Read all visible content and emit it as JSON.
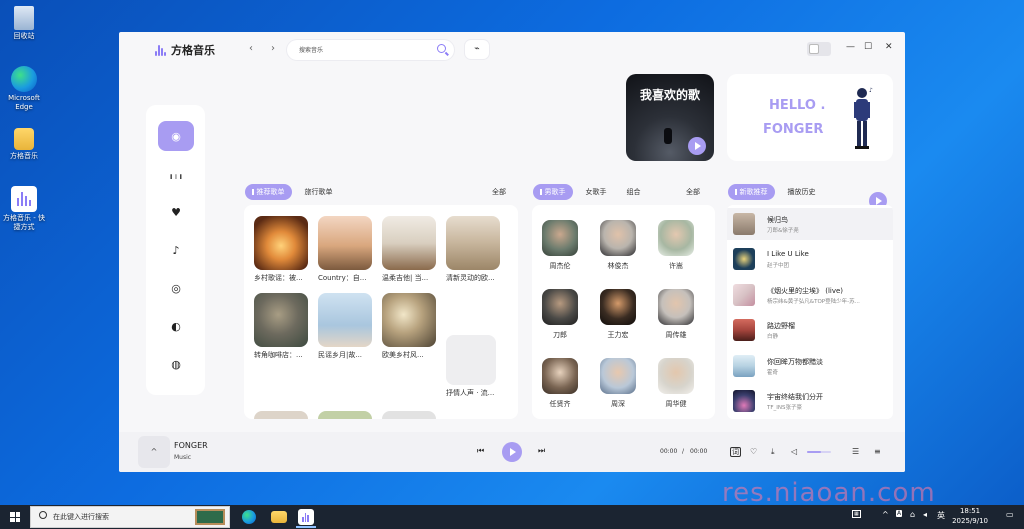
{
  "desktop": {
    "icons": [
      {
        "label": "回收站",
        "icon": "recycle-bin-icon"
      },
      {
        "label": "Microsoft Edge",
        "icon": "edge-icon"
      },
      {
        "label": "方格音乐",
        "icon": "folder-icon"
      },
      {
        "label": "方格音乐 - 快捷方式",
        "icon": "app-shortcut-icon"
      }
    ]
  },
  "app": {
    "name": "方格音乐",
    "search": {
      "placeholder": "搜索音乐"
    },
    "nav_back": "‹",
    "nav_forward": "›",
    "pulse": "⌁",
    "window": {
      "minimize": "—",
      "maximize": "☐",
      "close": "✕"
    }
  },
  "sidebar": {
    "items": [
      {
        "name": "disc-icon",
        "glyph": "◉"
      },
      {
        "name": "chart-icon",
        "glyph": "╻╷╻"
      },
      {
        "name": "heart-icon",
        "glyph": "♥"
      },
      {
        "name": "note-icon",
        "glyph": "♪"
      },
      {
        "name": "radar-icon",
        "glyph": "◎"
      },
      {
        "name": "toggle-icon",
        "glyph": "◐"
      },
      {
        "name": "leaf-icon",
        "glyph": "◍"
      }
    ]
  },
  "banners": {
    "favorite": "我喜欢的歌",
    "hello_line1": "HELLO .",
    "hello_line2": "FONGER"
  },
  "playlists": {
    "tabs": [
      "推荐歌单",
      "旅行歌单"
    ],
    "all": "全部",
    "items": [
      {
        "name": "乡村歌谣：被...",
        "color": "#c46a2a"
      },
      {
        "name": "Country：自...",
        "color": "#c9a37a"
      },
      {
        "name": "温柔吉他| 当...",
        "color": "#d9cfc0"
      },
      {
        "name": "清新灵动的欧...",
        "color": "#c7b59c"
      },
      {
        "name": "转角咖啡店：...",
        "color": "#6d6a5e"
      },
      {
        "name": "民谣乡月|故...",
        "color": "#a9c6de"
      },
      {
        "name": "欧美乡村风...",
        "color": "#8e7a63"
      },
      {
        "name": "抒情人声 · 流...",
        "color": "#eeeef0"
      }
    ]
  },
  "singers": {
    "tabs": [
      "男歌手",
      "女歌手",
      "组合"
    ],
    "all": "全部",
    "items": [
      {
        "name": "周杰伦",
        "color": "#6b7b6d"
      },
      {
        "name": "林俊杰",
        "color": "#d9d5cf"
      },
      {
        "name": "许嵩",
        "color": "#a7b7a2"
      },
      {
        "name": "刀郎",
        "color": "#4b4a47"
      },
      {
        "name": "王力宏",
        "color": "#3a2c22"
      },
      {
        "name": "周传雄",
        "color": "#c5c0bb"
      },
      {
        "name": "任贤齐",
        "color": "#7a6553"
      },
      {
        "name": "周深",
        "color": "#b9c8d8"
      },
      {
        "name": "周华健",
        "color": "#d7d4cc"
      }
    ]
  },
  "new_songs": {
    "tabs": [
      "新歌推荐",
      "播放历史"
    ],
    "items": [
      {
        "title": "候归鸟",
        "artist": "刀郎&徐子尧",
        "color": "#8a7a6c"
      },
      {
        "title": "I Like U Like",
        "artist": "赵子中团",
        "color": "#1d3f5a"
      },
      {
        "title": "《烟火里的尘埃》 (live)",
        "artist": "杨宗纬&黄子弘凡&TOP登陆少年-苏...",
        "color": "#d8c2c5"
      },
      {
        "title": "路边野榴",
        "artist": "白静",
        "color": "#a6453d"
      },
      {
        "title": "你回眸万物都黯淡",
        "artist": "霍奇",
        "color": "#b7d2e2"
      },
      {
        "title": "宇宙终结我们分开",
        "artist": "TF_INS张子豪",
        "color": "#3b3f6e"
      }
    ]
  },
  "player": {
    "cover": "^",
    "title": "FONGER",
    "subtitle": "Music",
    "prev": "⏮",
    "next": "⏭",
    "time_current": "00:00",
    "time_sep": "/",
    "time_total": "00:00",
    "volume": 0.6,
    "right_icons": [
      "lyrics-icon",
      "like-icon",
      "download-icon",
      "volume-icon",
      "playlist-icon",
      "queue-icon"
    ]
  },
  "watermark": "res.niaoan.com",
  "taskbar": {
    "search_placeholder": "在此键入进行搜索",
    "tray_lang": "英",
    "time": "18:51",
    "date": "2025/9/10"
  },
  "colors": {
    "accent": "#a89cf2",
    "desktop_blue": "#0d6ce0",
    "taskbar": "#1b2431"
  }
}
